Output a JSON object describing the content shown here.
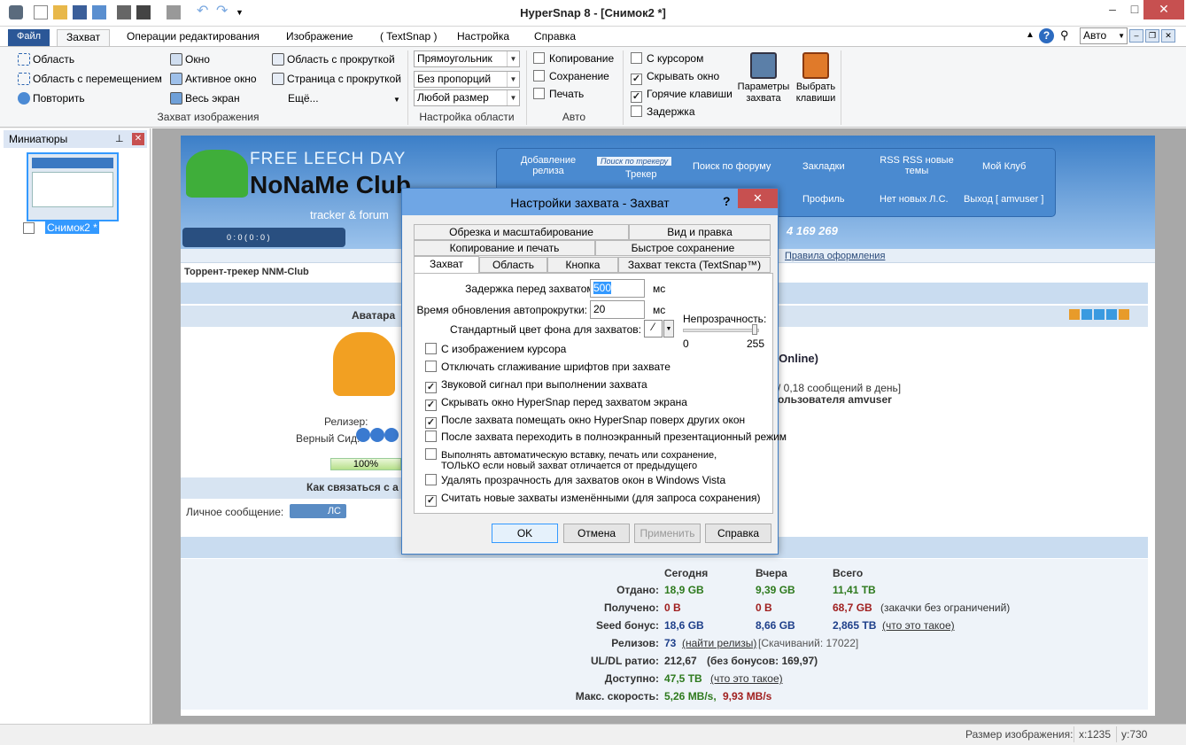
{
  "window": {
    "title": "HyperSnap 8 - [Снимок2 *]"
  },
  "tabs": {
    "file": "Файл",
    "capture": "Захват",
    "edit": "Операции редактирования",
    "image": "Изображение",
    "textsnap": "( TextSnap )",
    "settings": "Настройка",
    "help": "Справка"
  },
  "zoom": {
    "value": "Авто"
  },
  "ribbon": {
    "area": "Область",
    "area_move": "Область с перемещением",
    "repeat": "Повторить",
    "window": "Окно",
    "active_window": "Активное окно",
    "full_screen": "Весь экран",
    "scroll_area": "Область с прокруткой",
    "scroll_page": "Страница с прокруткой",
    "more": "Ещё...",
    "group_capture": "Захват изображения",
    "shape": "Прямоугольник",
    "proportions": "Без пропорций",
    "size": "Любой размер",
    "group_area": "Настройка области",
    "copy": "Копирование",
    "save": "Сохранение",
    "print": "Печать",
    "group_auto": "Авто",
    "with_cursor": "С курсором",
    "hide_window": "Скрывать окно",
    "hotkeys": "Горячие клавиши",
    "delay": "Задержка",
    "capture_params": "Параметры захвата",
    "choose_keys": "Выбрать клавиши"
  },
  "thumbs": {
    "title": "Миниатюры",
    "item": "Снимок2 *"
  },
  "status": {
    "size_label": "Размер изображения:",
    "x": "x:1235",
    "y": "y:730"
  },
  "dialog": {
    "title": "Настройки захвата - Захват",
    "help": "?",
    "tabs_row1": [
      "Обрезка и масштабирование",
      "Вид и правка"
    ],
    "tabs_row2": [
      "Копирование и печать",
      "Быстрое сохранение"
    ],
    "tabs_row3": [
      "Захват",
      "Область",
      "Кнопка",
      "Захват текста (TextSnap™)"
    ],
    "delay_label": "Задержка перед захватом:",
    "delay_value": "500",
    "delay_unit": "мс",
    "refresh_label": "Время обновления автопрокрутки:",
    "refresh_value": "20",
    "refresh_unit": "мс",
    "bg_label": "Стандартный цвет фона для захватов:",
    "opacity_label": "Непрозрачность:",
    "opacity_min": "0",
    "opacity_max": "255",
    "options": [
      {
        "label": "С изображением курсора",
        "checked": false
      },
      {
        "label": "Отключать сглаживание шрифтов при захвате",
        "checked": false
      },
      {
        "label": "Звуковой сигнал при выполнении захвата",
        "checked": true
      },
      {
        "label": "Скрывать окно HyperSnap перед захватом экрана",
        "checked": true
      },
      {
        "label": "После захвата помещать окно HyperSnap поверх других окон",
        "checked": true
      },
      {
        "label": "После захвата переходить в полноэкранный презентационный режим",
        "checked": false
      },
      {
        "label": "Выполнять автоматическую вставку, печать или сохранение,",
        "label2": "ТОЛЬКО если новый захват отличается от предыдущего",
        "checked": false
      },
      {
        "label": "Удалять прозрачность для захватов окон в Windows Vista",
        "checked": false
      },
      {
        "label": "Считать новые захваты изменёнными (для запроса сохранения)",
        "checked": true
      }
    ],
    "ok": "OK",
    "cancel": "Отмена",
    "apply": "Применить",
    "help_btn": "Справка"
  },
  "site": {
    "banner_top": "FREE LEECH DAY",
    "banner_name": "NoNaMe Club",
    "banner_sub": "tracker & forum",
    "player": "0 : 0     ( 0 : 0 )",
    "nav_top": [
      "Добавление релиза",
      "Поиск по трекеру",
      "Поиск по форуму",
      "Закладки",
      "RSS RSS новые темы",
      "Мой Клуб"
    ],
    "nav_tracker": "Трекер",
    "nav_bottom": [
      "Профиль",
      "Нет новых Л.С.",
      "Выход [ amvuser ]"
    ],
    "counter": "4 169 269",
    "rules": "Правила оформления",
    "crumb": "Торрент-трекер NNM-Club",
    "avatar": "Аватара",
    "online": "s (Online)",
    "msgs": "/ 0,18 сообщений в день]",
    "user": "ользователя amvuser",
    "release_lbl": "Релизер:",
    "seed_lbl": "Верный Сид:",
    "progress": "100%",
    "contact": "Как связаться с а",
    "pm_lbl": "Личное сообщение:",
    "pm_btn": "ЛС",
    "stats_head": [
      "Сегодня",
      "Вчера",
      "Всего"
    ],
    "stats": [
      {
        "l": "Отдано:",
        "a": "18,9 GB",
        "b": "9,39 GB",
        "c": "11,41 TB",
        "n": ""
      },
      {
        "l": "Получено:",
        "a": "0 B",
        "b": "0 B",
        "c": "68,7 GB",
        "n": "(закачки без ограничений)"
      },
      {
        "l": "Seed бонус:",
        "a": "18,6 GB",
        "b": "8,66 GB",
        "c": "2,865 TB",
        "n": "(что это такое)"
      }
    ],
    "releases_lbl": "Релизов:",
    "releases_val": "73",
    "releases_link": "(найти релизы)",
    "releases_dl": "[Скачиваний: 17022]",
    "ratio_lbl": "UL/DL ратио:",
    "ratio_val": "212,67",
    "ratio_nb": "(без бонусов: 169,97)",
    "avail_lbl": "Доступно:",
    "avail_val": "47,5 TB",
    "avail_link": "(что это такое)",
    "speed_lbl": "Макс. скорость:",
    "speed_up": "5,26 MB/s,",
    "speed_dn": "9,93 MB/s"
  }
}
